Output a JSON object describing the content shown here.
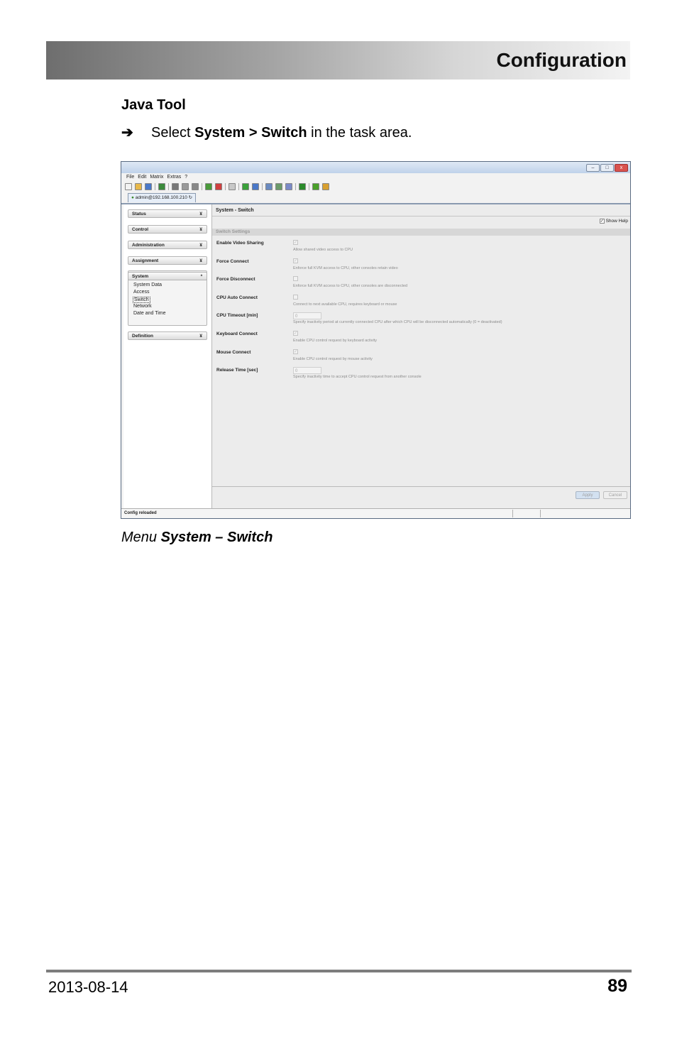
{
  "header": {
    "title": "Configuration"
  },
  "section": {
    "heading": "Java Tool"
  },
  "instruction": {
    "arrow": "➔",
    "prefix": "Select ",
    "bold": "System > Switch",
    "suffix": " in the task area."
  },
  "screenshot": {
    "window_buttons": [
      "–",
      "□",
      "x"
    ],
    "menu": [
      "File",
      "Edit",
      "Matrix",
      "Extras",
      "?"
    ],
    "toolbar_icon_colors": [
      "#f2f2f2",
      "#e8b84a",
      "#4a78c8",
      "#3b8a3b",
      "#777777",
      "#999999",
      "#888888",
      "#4a9a3a",
      "#d04040",
      "#c8c8c8",
      "#3aa03a",
      "#4a78c8",
      "#6a8ac0",
      "#6a9a6a",
      "#7a8ac8",
      "#2a8a2a",
      "#4aa02a",
      "#d8a030"
    ],
    "tab": {
      "label": "admin@192.168.100.210"
    },
    "sidebar": {
      "sections": [
        {
          "label": "Status",
          "chevron": "¥"
        },
        {
          "label": "Control",
          "chevron": "¥"
        },
        {
          "label": "Administration",
          "chevron": "¥"
        },
        {
          "label": "Assignment",
          "chevron": "¥"
        },
        {
          "label": "System",
          "chevron": "ª"
        },
        {
          "label": "Definition",
          "chevron": "¥"
        }
      ],
      "system_items": [
        "System Data",
        "Access",
        "Switch",
        "Network",
        "Date and Time"
      ]
    },
    "content": {
      "title": "System - Switch",
      "show_help": "Show Help",
      "section_label": "Switch Settings",
      "rows": [
        {
          "label": "Enable Video Sharing",
          "help": "Allow shared video access to CPU",
          "checked": true
        },
        {
          "label": "Force Connect",
          "help": "Enforce full KVM access to CPU, other consoles retain video",
          "checked": true
        },
        {
          "label": "Force Disconnect",
          "help": "Enforce full KVM access to CPU, other consoles are disconnected",
          "checked": false
        },
        {
          "label": "CPU Auto Connect",
          "help": "Connect to next available CPU, requires keyboard or mouse",
          "checked": false
        },
        {
          "label": "CPU Timeout [min]",
          "help": "Specify inactivity period at currently connected CPU after which CPU will be disconnected automatically (0 = deactivated)",
          "value": "0"
        },
        {
          "label": "Keyboard Connect",
          "help": "Enable CPU control request by keyboard activity",
          "checked": true
        },
        {
          "label": "Mouse Connect",
          "help": "Enable CPU control request by mouse activity",
          "checked": true
        },
        {
          "label": "Release Time [sec]",
          "help": "Specify inactivity time to accept CPU control request from another console",
          "value": "0"
        }
      ],
      "apply": "Apply",
      "cancel": "Cancel"
    },
    "status": "Config reloaded"
  },
  "caption": {
    "prefix": "Menu ",
    "bold": "System – Switch"
  },
  "footer": {
    "date": "2013-08-14",
    "page": "89"
  }
}
